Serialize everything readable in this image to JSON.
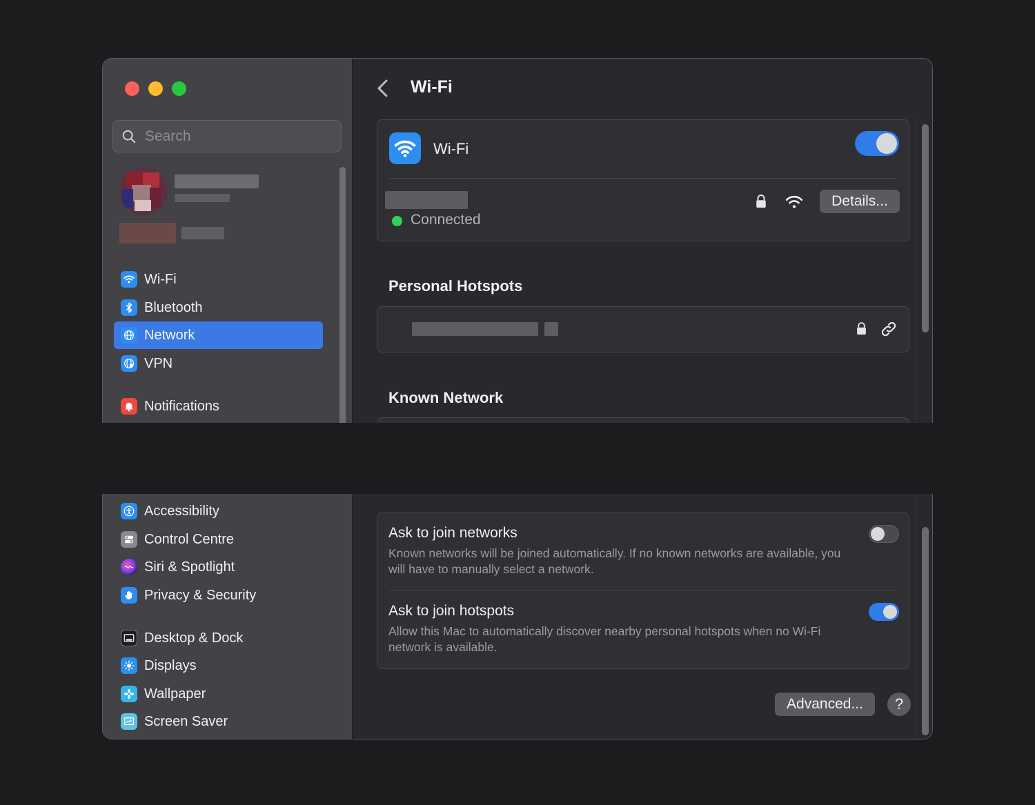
{
  "window": {
    "search_placeholder": "Search"
  },
  "sidebar": {
    "items_top": [
      {
        "label": "Wi-Fi",
        "icon": "wifi-icon",
        "color": "#2d8ef0"
      },
      {
        "label": "Bluetooth",
        "icon": "bluetooth-icon",
        "color": "#2d8ef0"
      },
      {
        "label": "Network",
        "icon": "globe-icon",
        "color": "#2d8ef0"
      },
      {
        "label": "VPN",
        "icon": "vpn-globe-icon",
        "color": "#2d8ef0"
      },
      {
        "label": "Notifications",
        "icon": "bell-icon",
        "color": "#f0473f"
      }
    ],
    "items_bottom": [
      {
        "label": "Accessibility",
        "icon": "accessibility-icon",
        "color": "#2d8ef0"
      },
      {
        "label": "Control Centre",
        "icon": "control-centre-icon",
        "color": "#8a8a8e"
      },
      {
        "label": "Siri & Spotlight",
        "icon": "siri-icon",
        "color": "#7b3fe4"
      },
      {
        "label": "Privacy & Security",
        "icon": "hand-icon",
        "color": "#2d8ef0"
      },
      {
        "label": "Desktop & Dock",
        "icon": "dock-icon",
        "color": "#1d1d1f"
      },
      {
        "label": "Displays",
        "icon": "sun-icon",
        "color": "#2d8ef0"
      },
      {
        "label": "Wallpaper",
        "icon": "flower-icon",
        "color": "#35b6e8"
      },
      {
        "label": "Screen Saver",
        "icon": "screensaver-icon",
        "color": "#5fc3e8"
      }
    ],
    "active": "Network"
  },
  "main": {
    "title": "Wi-Fi",
    "wifi_row": {
      "label": "Wi-Fi",
      "enabled": true
    },
    "connected_status": "Connected",
    "details_button": "Details...",
    "personal_hotspots_title": "Personal Hotspots",
    "known_network_title": "Known Network",
    "options": [
      {
        "title": "Ask to join networks",
        "description": "Known networks will be joined automatically. If no known networks are available, you will have to manually select a network.",
        "enabled": false
      },
      {
        "title": "Ask to join hotspots",
        "description": "Allow this Mac to automatically discover nearby personal hotspots when no Wi-Fi network is available.",
        "enabled": true
      }
    ],
    "advanced_button": "Advanced...",
    "help_button": "?"
  },
  "colors": {
    "accent": "#3b7ae4",
    "toggle_on": "#2f7de6",
    "connected_dot": "#30d158"
  }
}
